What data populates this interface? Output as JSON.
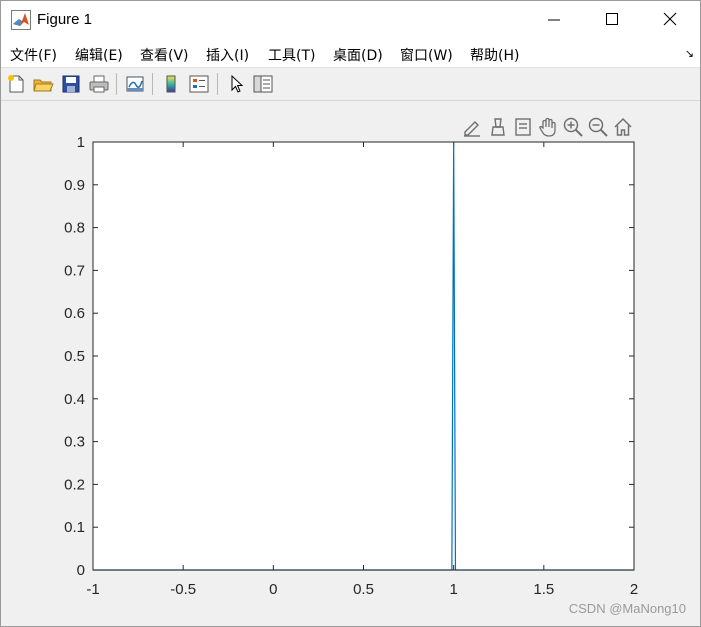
{
  "window": {
    "title": "Figure 1"
  },
  "menu": [
    {
      "label": "文件(F)"
    },
    {
      "label": "编辑(E)"
    },
    {
      "label": "查看(V)"
    },
    {
      "label": "插入(I)"
    },
    {
      "label": "工具(T)"
    },
    {
      "label": "桌面(D)"
    },
    {
      "label": "窗口(W)"
    },
    {
      "label": "帮助(H)"
    }
  ],
  "toolbar": {
    "icons": [
      "new-figure-icon",
      "open-file-icon",
      "save-icon",
      "print-icon",
      "link-plot-icon",
      "colorbar-icon",
      "legend-icon",
      "edit-plot-icon",
      "property-inspector-icon"
    ]
  },
  "axes_toolbar": {
    "icons": [
      "export-icon",
      "brush-icon",
      "data-tips-icon",
      "pan-icon",
      "zoom-in-icon",
      "zoom-out-icon",
      "home-icon"
    ]
  },
  "colors": {
    "line": "#0072bd",
    "axes_bg": "#ffffff",
    "figure_bg": "#f0f0f0"
  },
  "chart_data": {
    "type": "line",
    "xlim": [
      -1,
      2
    ],
    "ylim": [
      0,
      1
    ],
    "x_ticks": [
      -1,
      -0.5,
      0,
      0.5,
      1,
      1.5,
      2
    ],
    "x_tick_labels": [
      "-1",
      "-0.5",
      "0",
      "0.5",
      "1",
      "1.5",
      "2"
    ],
    "y_ticks": [
      0,
      0.1,
      0.2,
      0.3,
      0.4,
      0.5,
      0.6,
      0.7,
      0.8,
      0.9,
      1
    ],
    "y_tick_labels": [
      "0",
      "0.1",
      "0.2",
      "0.3",
      "0.4",
      "0.5",
      "0.6",
      "0.7",
      "0.8",
      "0.9",
      "1"
    ],
    "grid": false,
    "series": [
      {
        "x": [
          -1,
          0.99,
          1,
          1.01,
          2
        ],
        "values": [
          0,
          0,
          1,
          0,
          0
        ]
      }
    ]
  },
  "watermark": "CSDN @MaNong10"
}
